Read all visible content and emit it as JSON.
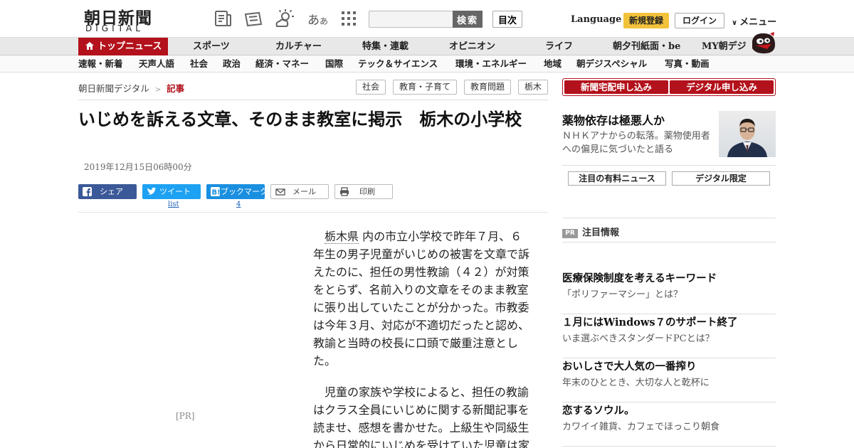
{
  "header": {
    "logo_kanji": "朝日新聞",
    "logo_digital": "DIGITAL",
    "font_size_label_main": "あ",
    "font_size_label_small": "あ",
    "search_placeholder": "",
    "search_button": "検索",
    "toc_button": "目次",
    "language": "Language",
    "register": "新規登録",
    "login": "ログイン",
    "menu": "メニュー",
    "icons": [
      "news-list-icon",
      "paper-icon",
      "weather-icon",
      "font-size-icon",
      "apps-grid-icon"
    ]
  },
  "main_nav": {
    "active": "トップニュース",
    "items": [
      "スポーツ",
      "カルチャー",
      "特集・連載",
      "オピニオン",
      "ライフ",
      "朝夕刊紙面・be",
      "MY朝デジ"
    ]
  },
  "sub_nav": {
    "items": [
      "速報・新着",
      "天声人語",
      "社会",
      "政治",
      "経済・マネー",
      "国際",
      "テック＆サイエンス",
      "環境・エネルギー",
      "地域",
      "朝デジスペシャル",
      "写真・動画"
    ]
  },
  "breadcrumb": {
    "home": "朝日新聞デジタル",
    "separator": ">",
    "current": "記事"
  },
  "tags": [
    "社会",
    "教育・子育て",
    "教育問題",
    "栃木"
  ],
  "article": {
    "title": "いじめを訴える文章、そのまま教室に掲示　栃木の小学校",
    "date": "2019年12月15日06時00分",
    "share": {
      "facebook": "シェア",
      "twitter": "ツイート",
      "twitter_count": "list",
      "hatena": "ブックマーク",
      "hatena_count": "4",
      "mail": "メール",
      "print": "印刷"
    },
    "pr_label": "[PR]",
    "p1_link": "栃木県",
    "p1_rest": "内の市立小学校で昨年７月、６年生の男子児童がいじめの被害を文章で訴えたのに、担任の男性教諭（４２）が対策をとらず、名前入りの文章をそのまま教室に張り出していたことが分かった。市教委は今年３月、対応が不適切だったと認め、教諭と当時の校長に口頭で厳重注意とした。",
    "p2": "児童の家族や学校によると、担任の教諭はクラス全員にいじめに関する新聞記事を読ませ、感想を書かせた。上級生や同級生から日常的にいじめを受けていた児童は家"
  },
  "sidebar": {
    "subscribe_home": "新聞宅配申し込み",
    "subscribe_digital": "デジタル申し込み",
    "feature_title": "薬物依存は極悪人か",
    "feature_desc": "ＮＨＫアナからの転落。薬物使用者への偏見に気づいたと語る",
    "tab_paid": "注目の有料ニュース",
    "tab_digital": "デジタル限定",
    "pr_badge": "PR",
    "pr_heading": "注目情報",
    "pr_items": [
      {
        "title": "医療保険制度を考えるキーワード",
        "desc": "「ポリファーマシー」とは？"
      },
      {
        "title": "１月にはWindows７のサポート終了",
        "desc": "いま選ぶべきスタンダードPCとは？"
      },
      {
        "title": "おいしさで大人気の一番搾り",
        "desc": "年末のひととき、大切な人と乾杯に"
      },
      {
        "title": "恋するソウル。",
        "desc": "カワイイ雑貨、カフェでほっこり朝食"
      }
    ]
  },
  "colors": {
    "brand_red": "#b3111b",
    "register_yellow": "#f2c23a",
    "facebook": "#3b5998",
    "twitter": "#1da1f2",
    "hatena": "#1a8fe0"
  }
}
